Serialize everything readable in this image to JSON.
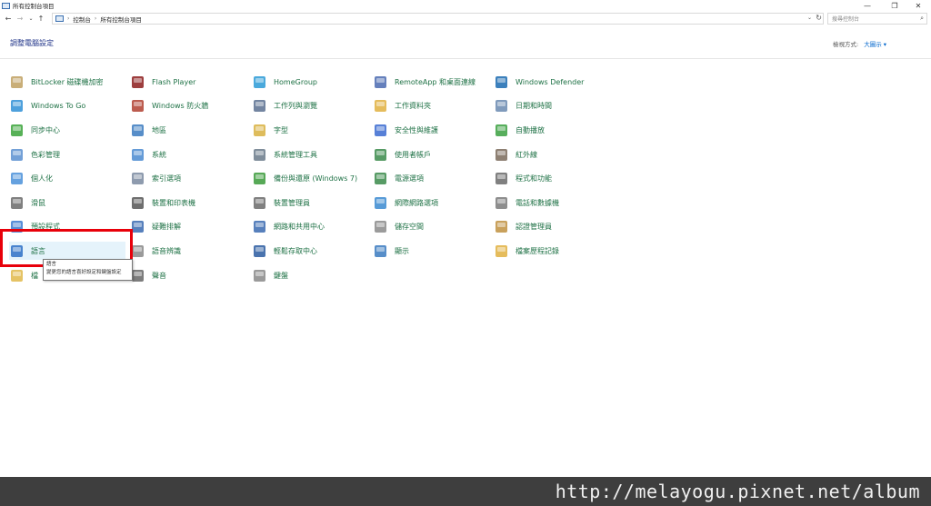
{
  "window": {
    "title": "所有控制台項目",
    "minimize_glyph": "—",
    "restore_glyph": "❐",
    "close_glyph": "✕"
  },
  "nav": {
    "back_glyph": "←",
    "forward_glyph": "→",
    "recent_glyph": "⌄",
    "up_glyph": "↑",
    "breadcrumb": [
      "控制台",
      "所有控制台項目"
    ],
    "breadcrumb_sep": "›",
    "dropdown_glyph": "⌄",
    "refresh_glyph": "↻",
    "search_placeholder": "搜尋控制台"
  },
  "header": {
    "title": "調整電腦設定",
    "view_by_label": "檢視方式:",
    "view_by_value": "大圖示 ▾"
  },
  "items": [
    {
      "label": "BitLocker 磁碟機加密",
      "icon": "bitlocker-icon",
      "color": "#c0a060"
    },
    {
      "label": "Windows To Go",
      "icon": "windows-to-go-icon",
      "color": "#2f8fd6"
    },
    {
      "label": "同步中心",
      "icon": "sync-center-icon",
      "color": "#3aa33a"
    },
    {
      "label": "色彩管理",
      "icon": "color-management-icon",
      "color": "#5b8fd0"
    },
    {
      "label": "個人化",
      "icon": "personalization-icon",
      "color": "#4a90d9"
    },
    {
      "label": "滑鼠",
      "icon": "mouse-icon",
      "color": "#6a6a6a"
    },
    {
      "label": "預設程式",
      "icon": "default-programs-icon",
      "color": "#3b7bd1"
    },
    {
      "label": "語言",
      "icon": "language-icon",
      "color": "#2d6ec6"
    },
    {
      "label": "檔",
      "icon": "folder-options-icon",
      "color": "#e0b84a"
    },
    {
      "label": "Flash Player",
      "icon": "flash-player-icon",
      "color": "#8c1c1c"
    },
    {
      "label": "Windows 防火牆",
      "icon": "firewall-icon",
      "color": "#b04030"
    },
    {
      "label": "地區",
      "icon": "region-icon",
      "color": "#3a7ac0"
    },
    {
      "label": "系統",
      "icon": "system-icon",
      "color": "#4a8ad0"
    },
    {
      "label": "索引選項",
      "icon": "indexing-options-icon",
      "color": "#7a8aa0"
    },
    {
      "label": "裝置和印表機",
      "icon": "devices-printers-icon",
      "color": "#555555"
    },
    {
      "label": "疑難排解",
      "icon": "troubleshooting-icon",
      "color": "#3a6ab0"
    },
    {
      "label": "語音辨識",
      "icon": "speech-recognition-icon",
      "color": "#888888"
    },
    {
      "label": "聲音",
      "icon": "sound-icon",
      "color": "#666666"
    },
    {
      "label": "HomeGroup",
      "icon": "homegroup-icon",
      "color": "#2a9ad6"
    },
    {
      "label": "工作列與瀏覽",
      "icon": "taskbar-icon",
      "color": "#5a7090"
    },
    {
      "label": "字型",
      "icon": "fonts-icon",
      "color": "#d8b040"
    },
    {
      "label": "系統管理工具",
      "icon": "admin-tools-icon",
      "color": "#6a7a8a"
    },
    {
      "label": "備份與還原 (Windows 7)",
      "icon": "backup-restore-icon",
      "color": "#3a9a3a"
    },
    {
      "label": "裝置管理員",
      "icon": "device-manager-icon",
      "color": "#6a6a6a"
    },
    {
      "label": "網路和共用中心",
      "icon": "network-sharing-icon",
      "color": "#3a6ab0"
    },
    {
      "label": "輕鬆存取中心",
      "icon": "ease-of-access-icon",
      "color": "#2a5aa0"
    },
    {
      "label": "鍵盤",
      "icon": "keyboard-icon",
      "color": "#888888"
    },
    {
      "label": "RemoteApp 和桌面連線",
      "icon": "remoteapp-icon",
      "color": "#4a6ab0"
    },
    {
      "label": "工作資料夾",
      "icon": "work-folders-icon",
      "color": "#e0b040"
    },
    {
      "label": "安全性與維護",
      "icon": "security-maintenance-icon",
      "color": "#3a6ad0"
    },
    {
      "label": "使用者帳戶",
      "icon": "user-accounts-icon",
      "color": "#3a8a4a"
    },
    {
      "label": "電源選項",
      "icon": "power-options-icon",
      "color": "#3a8a4a"
    },
    {
      "label": "網際網路選項",
      "icon": "internet-options-icon",
      "color": "#3a8ad0"
    },
    {
      "label": "儲存空間",
      "icon": "storage-spaces-icon",
      "color": "#8a8a8a"
    },
    {
      "label": "顯示",
      "icon": "display-icon",
      "color": "#3a7ac0"
    },
    {
      "label": "Windows Defender",
      "icon": "windows-defender-icon",
      "color": "#1a6ab0"
    },
    {
      "label": "日期和時間",
      "icon": "date-time-icon",
      "color": "#6a8ab0"
    },
    {
      "label": "自動播放",
      "icon": "autoplay-icon",
      "color": "#3aa040"
    },
    {
      "label": "紅外線",
      "icon": "infrared-icon",
      "color": "#7a6a5a"
    },
    {
      "label": "程式和功能",
      "icon": "programs-features-icon",
      "color": "#6a6a6a"
    },
    {
      "label": "電話和數據機",
      "icon": "phone-modem-icon",
      "color": "#7a7a7a"
    },
    {
      "label": "認證管理員",
      "icon": "credential-manager-icon",
      "color": "#c09040"
    },
    {
      "label": "檔案歷程記錄",
      "icon": "file-history-icon",
      "color": "#e0b040"
    }
  ],
  "tooltip": {
    "title": "語言",
    "text": "變更您的語言喜好設定和鍵盤設定"
  },
  "watermark": "http://melayogu.pixnet.net/album"
}
